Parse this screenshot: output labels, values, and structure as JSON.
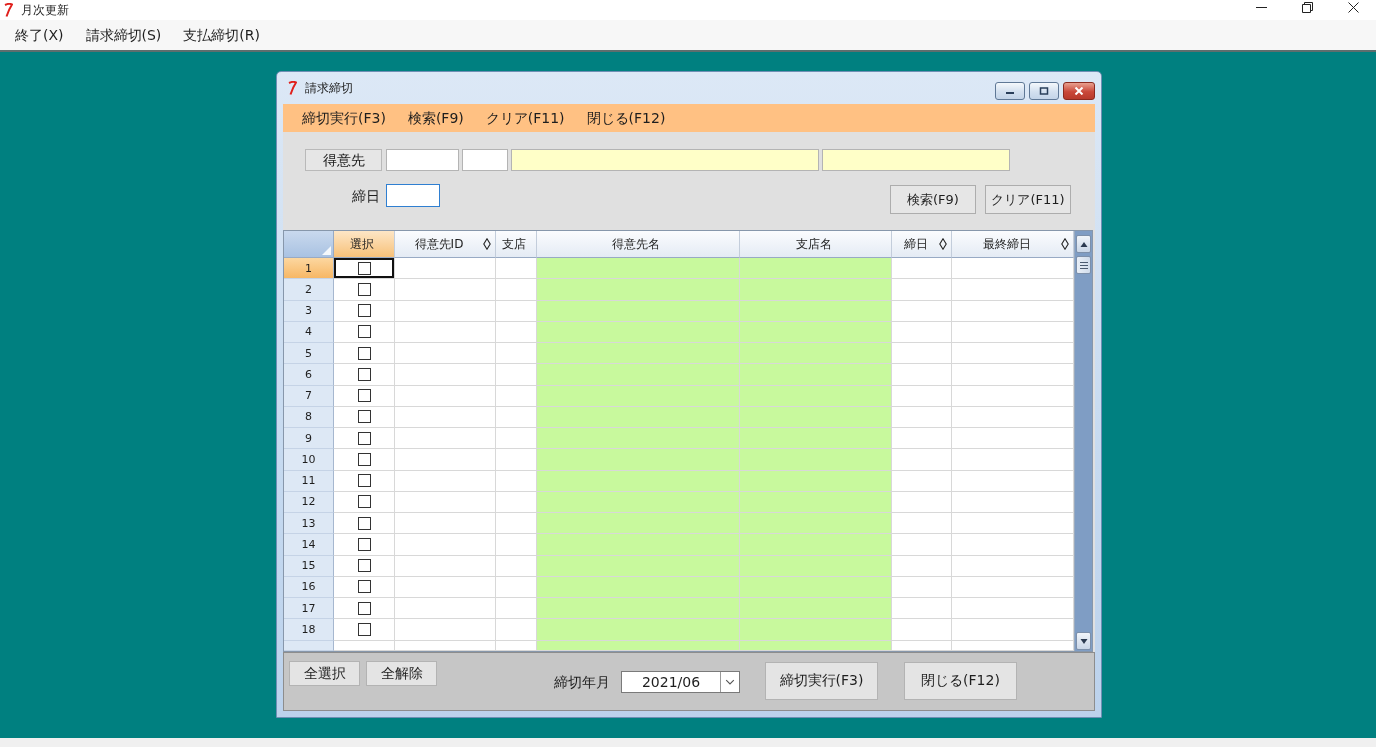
{
  "window": {
    "title": "月次更新"
  },
  "menu": [
    {
      "label": "終了(X)"
    },
    {
      "label": "請求締切(S)"
    },
    {
      "label": "支払締切(R)"
    }
  ],
  "dialog": {
    "title": "請求締切",
    "toolbar": [
      {
        "label": "締切実行(F3)"
      },
      {
        "label": "検索(F9)"
      },
      {
        "label": "クリア(F11)"
      },
      {
        "label": "閉じる(F12)"
      }
    ],
    "filter": {
      "customer_button": "得意先",
      "customer_fields": [
        {
          "kind": "input"
        },
        {
          "kind": "input"
        },
        {
          "kind": "display"
        },
        {
          "kind": "display"
        }
      ],
      "closing_day": {
        "label": "締日",
        "focused": true
      },
      "buttons": [
        {
          "label": "検索(F9)"
        },
        {
          "label": "クリア(F11)"
        }
      ]
    },
    "table": {
      "columns": [
        {
          "label": "選択",
          "kind": "check",
          "selected": true,
          "sortable": false
        },
        {
          "label": "得意先ID",
          "kind": "text",
          "selected": false,
          "sortable": true
        },
        {
          "label": "支店",
          "kind": "text",
          "selected": false,
          "sortable": false
        },
        {
          "label": "得意先名",
          "kind": "readonly",
          "selected": false,
          "sortable": false
        },
        {
          "label": "支店名",
          "kind": "readonly",
          "selected": false,
          "sortable": false
        },
        {
          "label": "締日",
          "kind": "text",
          "selected": false,
          "sortable": true
        },
        {
          "label": "最終締日",
          "kind": "text",
          "selected": false,
          "sortable": true
        }
      ],
      "rows": [
        {
          "number": "1",
          "selected": true,
          "checked": false
        },
        {
          "number": "2",
          "selected": false,
          "checked": false
        },
        {
          "number": "3",
          "selected": false,
          "checked": false
        },
        {
          "number": "4",
          "selected": false,
          "checked": false
        },
        {
          "number": "5",
          "selected": false,
          "checked": false
        },
        {
          "number": "6",
          "selected": false,
          "checked": false
        },
        {
          "number": "7",
          "selected": false,
          "checked": false
        },
        {
          "number": "8",
          "selected": false,
          "checked": false
        },
        {
          "number": "9",
          "selected": false,
          "checked": false
        },
        {
          "number": "10",
          "selected": false,
          "checked": false
        },
        {
          "number": "11",
          "selected": false,
          "checked": false
        },
        {
          "number": "12",
          "selected": false,
          "checked": false
        },
        {
          "number": "13",
          "selected": false,
          "checked": false
        },
        {
          "number": "14",
          "selected": false,
          "checked": false
        },
        {
          "number": "15",
          "selected": false,
          "checked": false
        },
        {
          "number": "16",
          "selected": false,
          "checked": false
        },
        {
          "number": "17",
          "selected": false,
          "checked": false
        },
        {
          "number": "18",
          "selected": false,
          "checked": false
        }
      ]
    },
    "footer": {
      "buttons_left": [
        {
          "label": "全選択"
        },
        {
          "label": "全解除"
        }
      ],
      "month": {
        "label": "締切年月",
        "value": "2021/06"
      },
      "buttons_right": [
        {
          "label": "締切実行(F3)"
        },
        {
          "label": "閉じる(F12)"
        }
      ]
    }
  }
}
